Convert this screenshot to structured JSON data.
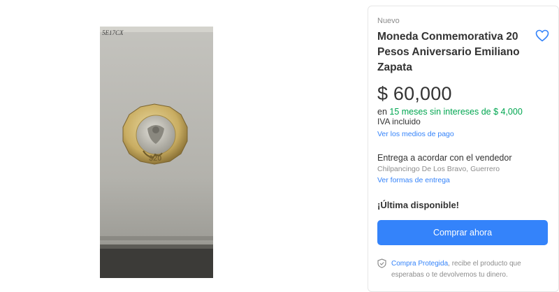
{
  "photo": {
    "icon": "coin-photo",
    "handwriting": "5E17CX"
  },
  "product": {
    "condition": "Nuevo",
    "title": "Moneda Conmemorativa 20 Pesos Aniversario Emiliano Zapata",
    "price": "$ 60,000",
    "installments_prefix": "en ",
    "installments_highlight": "15 meses sin intereses de $ 4,000",
    "iva": "IVA incluido",
    "payment_link": "Ver los medios de pago"
  },
  "delivery": {
    "title": "Entrega a acordar con el vendedor",
    "location": "Chilpancingo De Los Bravo, Guerrero",
    "link": "Ver formas de entrega"
  },
  "stock": "¡Última disponible!",
  "buy_button": "Comprar ahora",
  "protection": {
    "link": "Compra Protegida",
    "text": ", recibe el producto que esperabas o te devolvemos tu dinero."
  },
  "colors": {
    "accent": "#3483fa",
    "green": "#00a650",
    "text": "#333333",
    "muted": "#8c8c8c"
  },
  "icons": [
    "heart-icon",
    "shield-icon"
  ]
}
